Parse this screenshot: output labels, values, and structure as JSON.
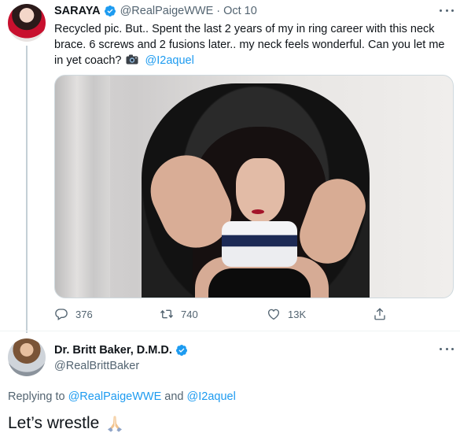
{
  "tweet": {
    "author_name": "SARAYA",
    "author_handle": "@RealPaigeWWE",
    "separator": "·",
    "date": "Oct 10",
    "text": "Recycled pic. But.. Spent the last 2 years of my in ring career with this neck brace. 6 screws and 2 fusions later.. my neck feels wonderful. Can you let me in yet coach?",
    "mention": "@I2aquel",
    "stats": {
      "replies": "376",
      "retweets": "740",
      "likes": "13K"
    }
  },
  "reply": {
    "author_name": "Dr. Britt Baker, D.M.D.",
    "author_handle": "@RealBrittBaker",
    "replying_prefix": "Replying to",
    "replying_mention_1": "@RealPaigeWWE",
    "replying_and": "and",
    "replying_mention_2": "@I2aquel",
    "text": "Let’s wrestle"
  },
  "colors": {
    "accent": "#1d9bf0",
    "secondary_text": "#536471",
    "primary_text": "#0f1419"
  },
  "icons": [
    "verified-badge-icon",
    "more-icon",
    "reply-icon",
    "retweet-icon",
    "like-icon",
    "share-icon",
    "camera-emoji-icon",
    "praying-hands-emoji-icon"
  ]
}
